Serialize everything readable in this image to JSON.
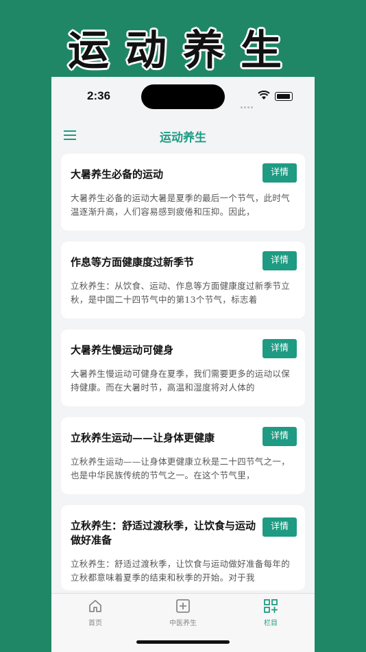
{
  "banner": {
    "title": "运动养生"
  },
  "status": {
    "time": "2:36"
  },
  "nav": {
    "title": "运动养生"
  },
  "detail_label": "详情",
  "articles": [
    {
      "title": "大暑养生必备的运动",
      "desc": "大暑养生必备的运动大暑是夏季的最后一个节气，此时气温逐渐升高，人们容易感到疲倦和压抑。因此，"
    },
    {
      "title": "作息等方面健康度过新季节",
      "desc": "立秋养生：从饮食、运动、作息等方面健康度过新季节立秋，是中国二十四节气中的第13个节气，标志着"
    },
    {
      "title": "大暑养生慢运动可健身",
      "desc": "大暑养生慢运动可健身在夏季，我们需要更多的运动以保持健康。而在大暑时节，高温和湿度将对人体的"
    },
    {
      "title": "立秋养生运动——让身体更健康",
      "desc": "立秋养生运动——让身体更健康立秋是二十四节气之一，也是中华民族传统的节气之一。在这个节气里，"
    },
    {
      "title": "立秋养生：舒适过渡秋季，让饮食与运动做好准备",
      "desc": "立秋养生：舒适过渡秋季，让饮食与运动做好准备每年的立秋都意味着夏季的结束和秋季的开始。对于我"
    }
  ],
  "tabs": [
    {
      "label": "首页",
      "icon": "home-icon"
    },
    {
      "label": "中医养生",
      "icon": "medical-cross-icon"
    },
    {
      "label": "栏目",
      "icon": "grid-icon"
    }
  ],
  "colors": {
    "accent": "#1e9b82",
    "background": "#1f8766"
  }
}
